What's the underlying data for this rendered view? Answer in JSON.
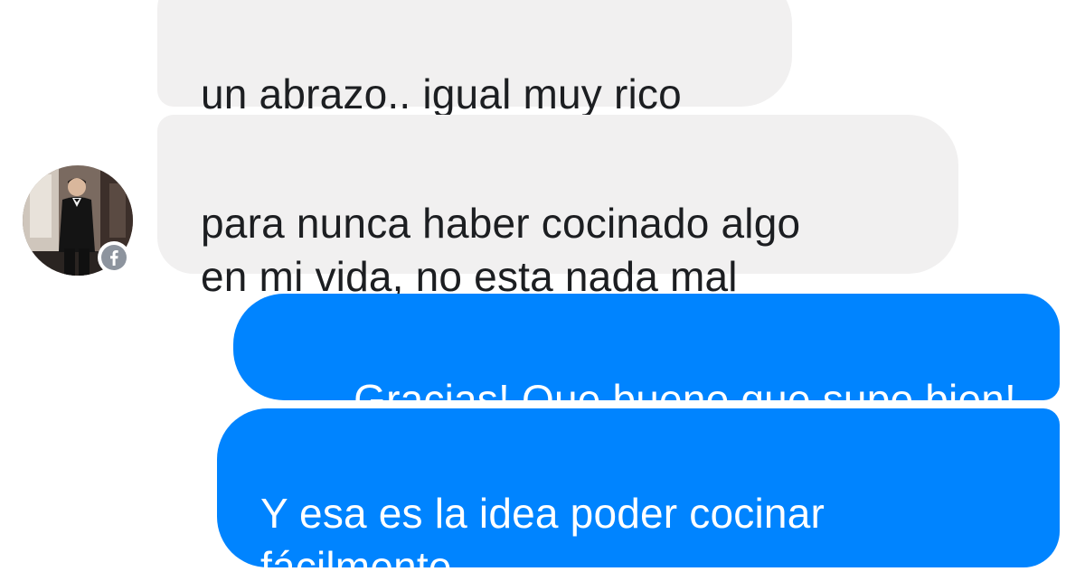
{
  "messages": [
    {
      "direction": "incoming",
      "text": "un abrazo.. igual muy rico"
    },
    {
      "direction": "incoming",
      "text": "para nunca haber cocinado algo\nen mi vida, no esta nada mal"
    },
    {
      "direction": "outgoing",
      "text": "Gracias! Que bueno que supo bien!"
    },
    {
      "direction": "outgoing",
      "text": "Y esa es la idea poder cocinar\nfácilmente"
    }
  ],
  "sender_avatar": {
    "badge_icon": "facebook-icon"
  },
  "colors": {
    "incoming_bubble": "#f1f0f0",
    "incoming_text": "#1c1e21",
    "outgoing_bubble": "#0084ff",
    "outgoing_text": "#ffffff",
    "badge": "#8d949e"
  }
}
